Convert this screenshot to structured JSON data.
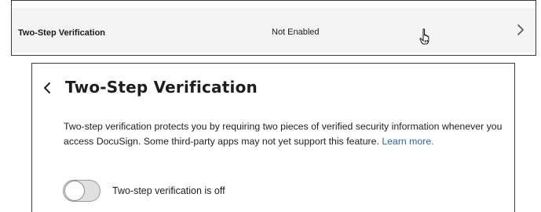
{
  "settings_row": {
    "label": "Two-Step Verification",
    "status": "Not Enabled"
  },
  "panel": {
    "title": "Two-Step Verification",
    "description_text": "Two-step verification protects you by requiring two pieces of verified security information whenever you access DocuSign. Some third-party apps may not yet support this feature. ",
    "learn_more_label": "Learn more.",
    "toggle": {
      "state": "off",
      "label": "Two-step verification is off"
    }
  },
  "icons": {
    "row_chevron": "chevron-right-icon",
    "back": "chevron-left-icon",
    "cursor": "hand-pointer-cursor-icon"
  }
}
